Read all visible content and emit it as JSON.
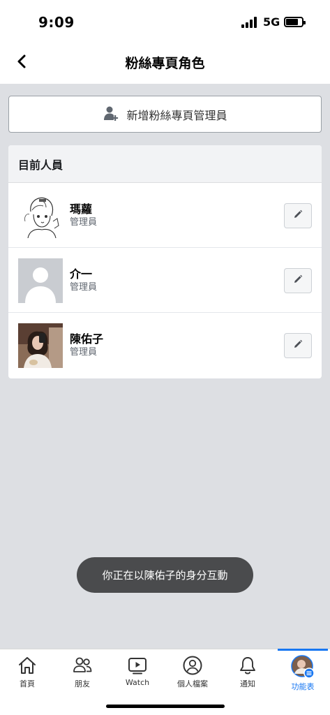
{
  "status_bar": {
    "time": "9:09",
    "network": "5G"
  },
  "header": {
    "title": "粉絲專頁角色",
    "back_icon": "chevron-left-icon"
  },
  "add_admin": {
    "label": "新增粉絲專頁管理員",
    "icon": "add-person-icon"
  },
  "people_section": {
    "title": "目前人員",
    "people": [
      {
        "name": "瑪蘿",
        "role": "管理員",
        "avatar": "sketch-portrait",
        "edit_icon": "pencil-icon"
      },
      {
        "name": "介一",
        "role": "管理員",
        "avatar": "default-silhouette",
        "edit_icon": "pencil-icon"
      },
      {
        "name": "陳佑子",
        "role": "管理員",
        "avatar": "photo-portrait",
        "edit_icon": "pencil-icon"
      }
    ]
  },
  "toast": {
    "text": "你正在以陳佑子的身分互動"
  },
  "tabs": [
    {
      "label": "首頁",
      "icon": "home-icon"
    },
    {
      "label": "朋友",
      "icon": "friends-icon"
    },
    {
      "label": "Watch",
      "icon": "watch-icon"
    },
    {
      "label": "個人檔案",
      "icon": "profile-icon"
    },
    {
      "label": "通知",
      "icon": "bell-icon"
    },
    {
      "label": "功能表",
      "icon": "menu-avatar-icon",
      "active": true
    }
  ],
  "colors": {
    "accent": "#1877f2",
    "background": "#dddfe3",
    "toast": "#4a4b4d"
  }
}
